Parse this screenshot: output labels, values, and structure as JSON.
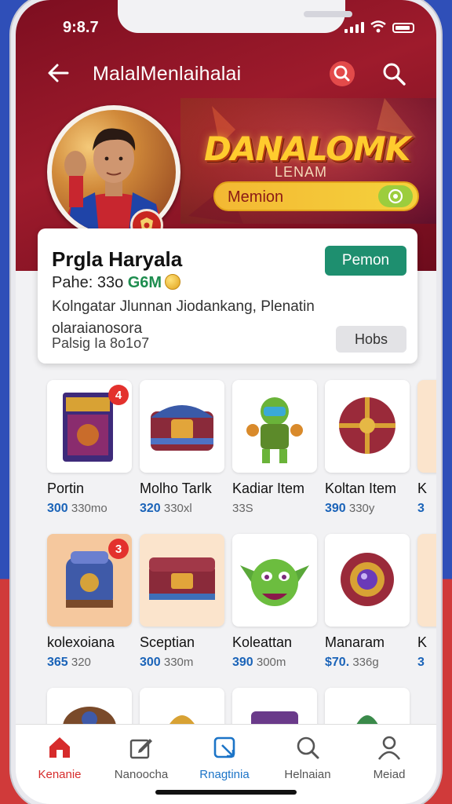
{
  "status_bar": {
    "time": "9:8.7"
  },
  "header": {
    "title": "MalalMenlaihalai"
  },
  "banner": {
    "title": "DANALOMK",
    "subtitle": "LENAM",
    "pill_label": "Memion"
  },
  "profile": {
    "name": "Prgla Haryala",
    "price_prefix": "Pahe: 33o ",
    "price_value": "G6M",
    "description": "Kolngatar Jlunnan Jiodankang, Plenatin olaraianosora",
    "meta": "Palsig Ia 8o1o7",
    "primary_button": "Pemon",
    "secondary_button": "Hobs"
  },
  "items": [
    {
      "name": "Portin",
      "price": "300",
      "sub": "330mo",
      "badge": "4"
    },
    {
      "name": "Molho Tarlk",
      "price": "320",
      "sub": "330xl",
      "badge": ""
    },
    {
      "name": "Kadiar Item",
      "price": "",
      "sub": "33S",
      "badge": ""
    },
    {
      "name": "Koltan Item",
      "price": "390",
      "sub": "330y",
      "badge": ""
    },
    {
      "name": "K",
      "price": "3",
      "sub": "",
      "badge": ""
    },
    {
      "name": "kolexoiana",
      "price": "365",
      "sub": "320",
      "badge": "3"
    },
    {
      "name": "Sceptian",
      "price": "300",
      "sub": "330m",
      "badge": ""
    },
    {
      "name": "Koleattan",
      "price": "390",
      "sub": "300m",
      "badge": ""
    },
    {
      "name": "Manaram",
      "price": "$70.",
      "sub": "336g",
      "badge": ""
    },
    {
      "name": "K",
      "price": "3",
      "sub": "",
      "badge": ""
    }
  ],
  "tabs": [
    {
      "label": "Kenanie",
      "icon": "home-icon",
      "active": true,
      "color": "#d62b2b"
    },
    {
      "label": "Nanoocha",
      "icon": "edit-icon",
      "active": false,
      "color": "#555555"
    },
    {
      "label": "Rnagtinia",
      "icon": "bookmark-icon",
      "active": false,
      "color": "#1c74c7"
    },
    {
      "label": "Helnaian",
      "icon": "search-icon",
      "active": false,
      "color": "#555555"
    },
    {
      "label": "Meiad",
      "icon": "user-icon",
      "active": false,
      "color": "#555555"
    }
  ]
}
